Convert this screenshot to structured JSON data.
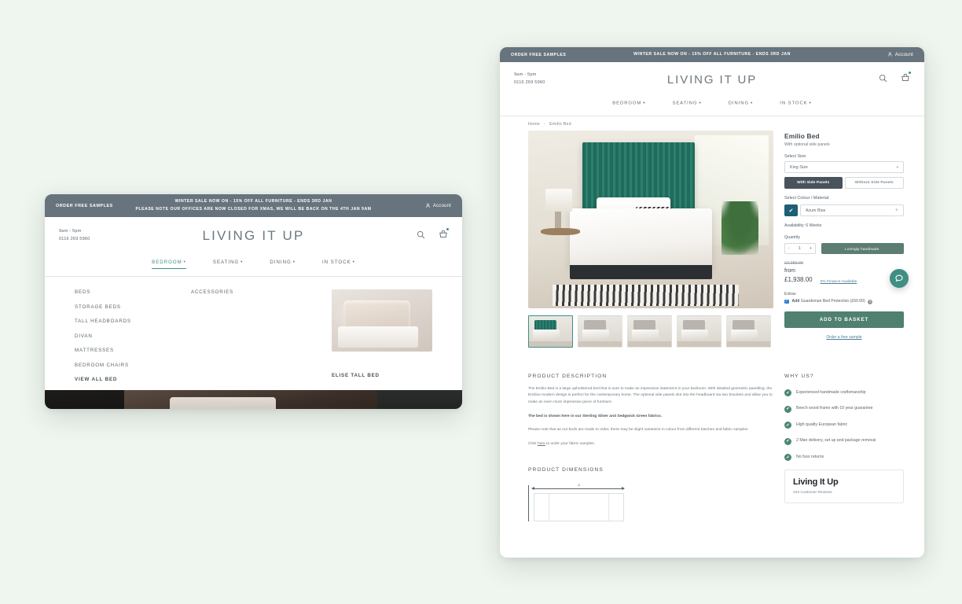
{
  "background_color": "#eff5ef",
  "brand": "LIVING IT UP",
  "accent_color": "#3f8f84",
  "utility_bar": {
    "left_label": "ORDER FREE SAMPLES",
    "promo_line_1": "WINTER SALE NOW ON - 15% OFF ALL FURNITURE - ENDS 3RD JAN",
    "promo_line_2": "PLEASE NOTE OUR OFFICES ARE NOW CLOSED FOR XMAS, WE WILL BE BACK ON THE 4TH JAN 9AM",
    "account_label": "Account",
    "account_icon": "user-icon",
    "background_color": "#67737d"
  },
  "header": {
    "hours": "9am - 5pm",
    "phone": "0116 269 5960",
    "search_icon": "search-icon",
    "cart_icon": "basket-icon"
  },
  "nav": [
    {
      "label": "BEDROOM",
      "caret": "▾",
      "active": true
    },
    {
      "label": "SEATING",
      "caret": "▾",
      "active": false
    },
    {
      "label": "DINING",
      "caret": "▾",
      "active": false
    },
    {
      "label": "IN STOCK",
      "caret": "▾",
      "active": false
    }
  ],
  "mega_menu": {
    "column_1": [
      "BEDS",
      "STORAGE BEDS",
      "TALL HEADBOARDS",
      "DIVAN",
      "MATTRESSES",
      "BEDROOM CHAIRS"
    ],
    "view_all": "VIEW ALL BED",
    "column_2": [
      "ACCESSORIES"
    ],
    "feature_caption": "ELISE TALL BED"
  },
  "breadcrumb": {
    "home": "Home",
    "separator": "›",
    "current": "Emilio Bed"
  },
  "product": {
    "title": "Emilio Bed",
    "subtitle": "With optional side panels",
    "size_label": "Select Size:",
    "size_value": "King Size",
    "size_chevron": "▾",
    "panel_option_on": "With Side Panels",
    "panel_option_off": "Without Side Panels",
    "colour_label": "Select Colour / Material:",
    "colour_value": "Azure Blue",
    "colour_swatch_hex": "#1d5f75",
    "colour_check": "✔",
    "colour_add": "+",
    "availability": "Availability: 6 Weeks",
    "quantity_label": "Quantity",
    "quantity_minus": "-",
    "quantity_value": "1",
    "quantity_plus": "+",
    "handmade_badge": "Lovingly handmade.",
    "price_was": "£2,280.00",
    "price_from_label": "from",
    "price_now": "£1,938.00",
    "finance_link": "0% Finance Available",
    "extras_label": "Extras",
    "extra_add": "Add",
    "extra_name": "Guardsman Bed Protection (£60.00)",
    "extra_info_icon": "info-icon",
    "add_to_basket": "ADD TO BASKET",
    "free_sample_link": "Order a free sample",
    "thumbnails": [
      {
        "name": "thumb-green-bed",
        "selected": true
      },
      {
        "name": "thumb-grey-bed-1",
        "selected": false
      },
      {
        "name": "thumb-grey-bed-2",
        "selected": false
      },
      {
        "name": "thumb-grey-bed-3",
        "selected": false
      },
      {
        "name": "thumb-grey-bed-4",
        "selected": false
      }
    ]
  },
  "description": {
    "heading": "PRODUCT DESCRIPTION",
    "paragraph_1": "The Emilio Bed is a large upholstered bed that is sure to make an impressive statement in your bedroom. With detailed geometric panelling, the Emilios modern design is perfect for the contemporary home. The optional side panels slot into the headboard via two brackets and allow you to make an even more impressive piece of furniture.",
    "paragraph_2": "The bed is shown here in our Sterling Silver and Sedgwick Green fabrics.",
    "paragraph_3": "Please note that as our beds are made to order, there may be slight variations in colour from different batches and fabric samples.",
    "paragraph_4_before": "Click ",
    "paragraph_4_link": "here",
    "paragraph_4_after": " to order your fabric samples."
  },
  "dimensions": {
    "heading": "PRODUCT DIMENSIONS",
    "arrow_label": "a"
  },
  "why_us": {
    "heading": "WHY US?",
    "tick_glyph": "✔",
    "items": [
      "Experienced handmade craftsmanship",
      "Beech wood frame with 10 year guarantee",
      "High quality European fabric",
      "2 Man delivery, set up and package removal",
      "No fuss returns"
    ]
  },
  "review_card": {
    "logo": "Living It Up",
    "count": "433 Customer Reviews"
  },
  "chat_widget": {
    "icon": "chat-bubble-icon",
    "color": "#3f8f84"
  }
}
